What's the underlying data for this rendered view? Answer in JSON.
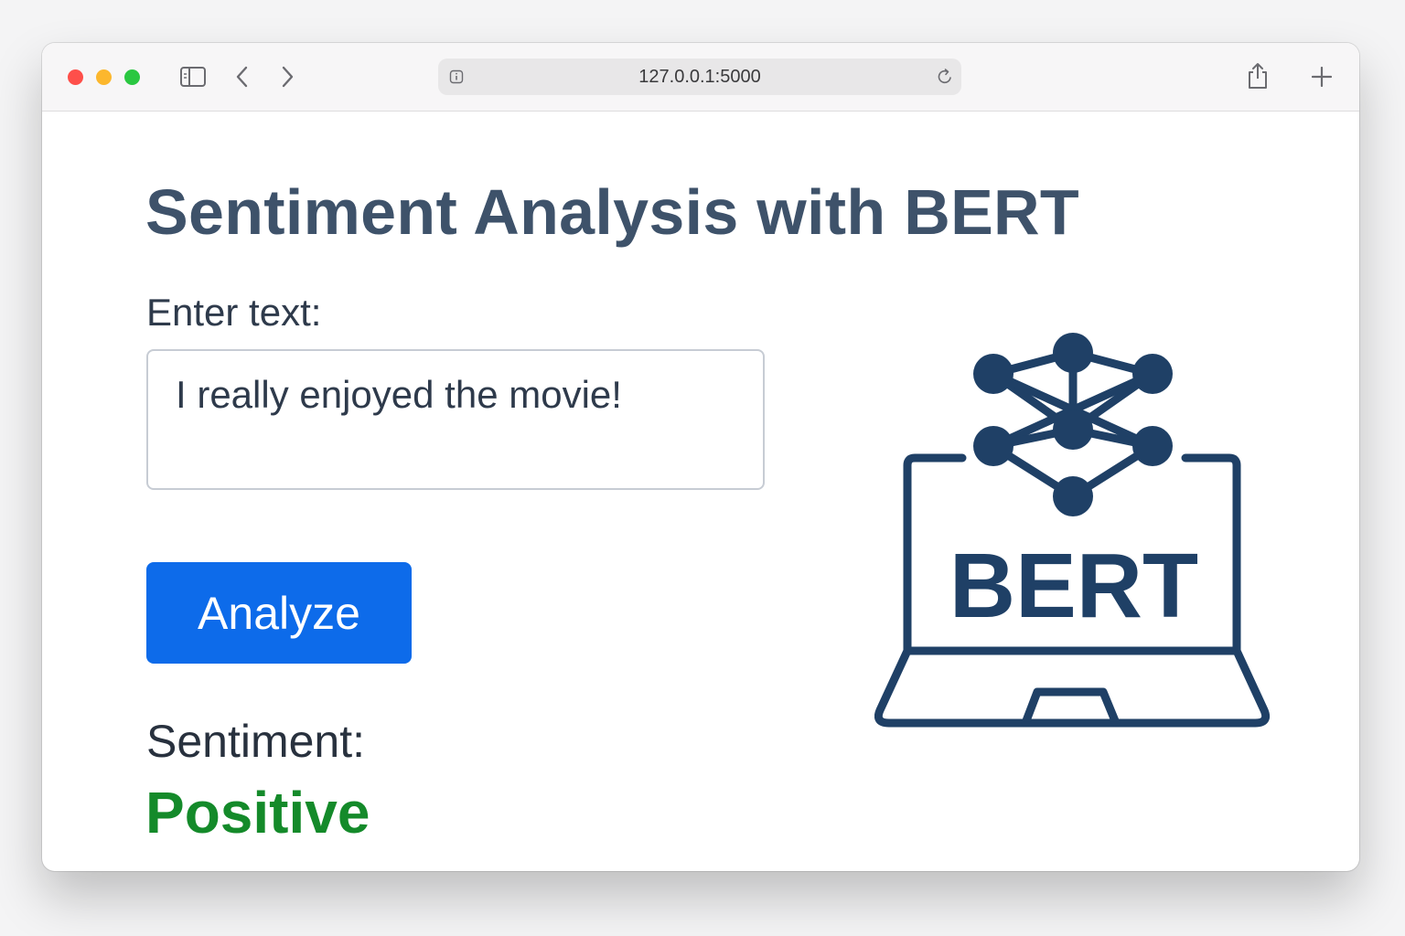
{
  "browser": {
    "url": "127.0.0.1:5000"
  },
  "page": {
    "title": "Sentiment Analysis with BERT",
    "input_label": "Enter text:",
    "input_value": "I really enjoyed the movie!",
    "analyze_button": "Analyze",
    "result_label": "Sentiment:",
    "result_value": "Positive",
    "logo_text": "BERT"
  },
  "colors": {
    "title": "#3e526a",
    "button": "#0d6bea",
    "positive": "#148a2a",
    "logo": "#1f4066"
  },
  "icons": [
    "sidebar-icon",
    "back-icon",
    "forward-icon",
    "site-info-icon",
    "reload-icon",
    "share-icon",
    "new-tab-icon",
    "bert-laptop-network-icon"
  ]
}
